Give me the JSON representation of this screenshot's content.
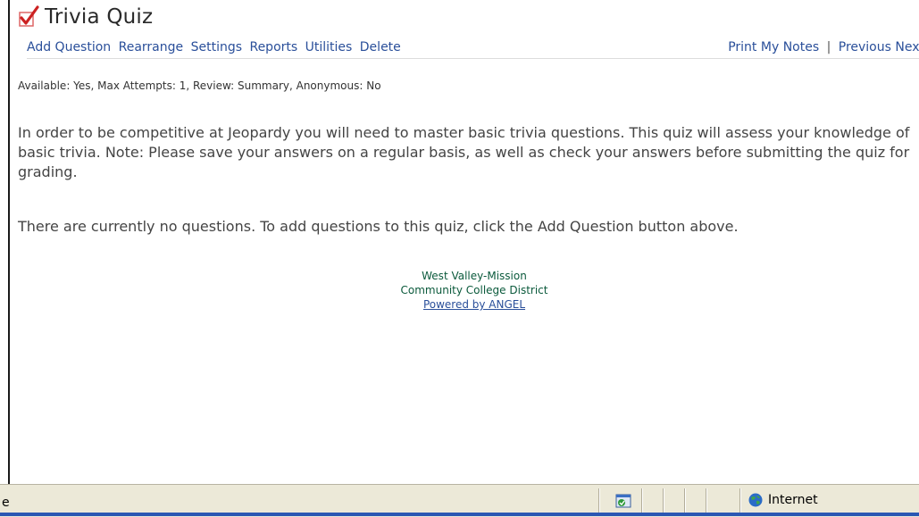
{
  "page": {
    "title": "Trivia Quiz",
    "title_icon": "checkmark-icon"
  },
  "toolbar": {
    "left": [
      "Add Question",
      "Rearrange",
      "Settings",
      "Reports",
      "Utilities",
      "Delete"
    ],
    "print": "Print",
    "my_notes": "My Notes",
    "separator": "|",
    "previous": "Previous",
    "next": "Next"
  },
  "quiz_status": "Available: Yes,  Max Attempts: 1,  Review: Summary,  Anonymous: No",
  "description": "In order to be competitive at Jeopardy you will need to master basic trivia questions. This quiz will assess your knowledge of basic trivia. Note: Please save your answers on a regular basis, as well as check your answers before submitting the quiz for grading.",
  "no_questions": "There are currently no questions. To add questions to this quiz, click the Add Question button above.",
  "footer": {
    "line1": "West Valley-Mission",
    "line2": "Community College District",
    "powered_by": "Powered by ANGEL"
  },
  "browser_status": {
    "text": "e",
    "zone_label": "Internet",
    "zone_icon": "globe-icon",
    "page_icon": "page-check-icon"
  },
  "colors": {
    "link": "#2a4f9a",
    "footer_text": "#0b5a3c",
    "title_check": "#cc2222",
    "statusbar_bg": "#ece9d8",
    "taskbar": "#2b57b3"
  }
}
